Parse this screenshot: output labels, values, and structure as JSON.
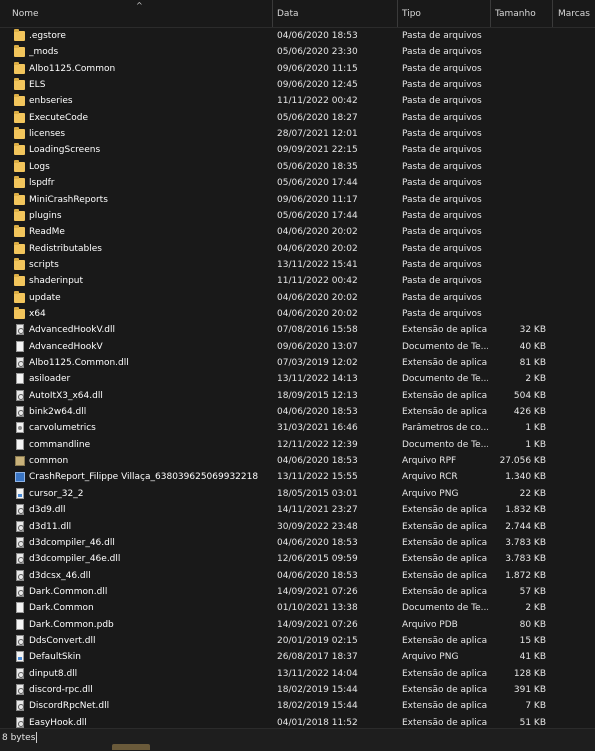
{
  "header": {
    "columns": [
      {
        "label": "Nome"
      },
      {
        "label": "Data"
      },
      {
        "label": "Tipo"
      },
      {
        "label": "Tamanho"
      },
      {
        "label": "Marcas"
      }
    ],
    "sort_indicator": "^"
  },
  "rows": [
    {
      "name": ".egstore",
      "date": "04/06/2020 18:53",
      "type": "Pasta de arquivos",
      "size": "",
      "icon": "folder-icon"
    },
    {
      "name": "_mods",
      "date": "05/06/2020 23:30",
      "type": "Pasta de arquivos",
      "size": "",
      "icon": "folder-icon"
    },
    {
      "name": "Albo1125.Common",
      "date": "09/06/2020 11:15",
      "type": "Pasta de arquivos",
      "size": "",
      "icon": "folder-icon"
    },
    {
      "name": "ELS",
      "date": "09/06/2020 12:45",
      "type": "Pasta de arquivos",
      "size": "",
      "icon": "folder-icon"
    },
    {
      "name": "enbseries",
      "date": "11/11/2022 00:42",
      "type": "Pasta de arquivos",
      "size": "",
      "icon": "folder-icon"
    },
    {
      "name": "ExecuteCode",
      "date": "05/06/2020 18:27",
      "type": "Pasta de arquivos",
      "size": "",
      "icon": "folder-icon"
    },
    {
      "name": "licenses",
      "date": "28/07/2021 12:01",
      "type": "Pasta de arquivos",
      "size": "",
      "icon": "folder-icon"
    },
    {
      "name": "LoadingScreens",
      "date": "09/09/2021 22:15",
      "type": "Pasta de arquivos",
      "size": "",
      "icon": "folder-icon"
    },
    {
      "name": "Logs",
      "date": "05/06/2020 18:35",
      "type": "Pasta de arquivos",
      "size": "",
      "icon": "folder-icon"
    },
    {
      "name": "lspdfr",
      "date": "05/06/2020 17:44",
      "type": "Pasta de arquivos",
      "size": "",
      "icon": "folder-icon"
    },
    {
      "name": "MiniCrashReports",
      "date": "09/06/2020 11:17",
      "type": "Pasta de arquivos",
      "size": "",
      "icon": "folder-icon"
    },
    {
      "name": "plugins",
      "date": "05/06/2020 17:44",
      "type": "Pasta de arquivos",
      "size": "",
      "icon": "folder-icon"
    },
    {
      "name": "ReadMe",
      "date": "04/06/2020 20:02",
      "type": "Pasta de arquivos",
      "size": "",
      "icon": "folder-icon"
    },
    {
      "name": "Redistributables",
      "date": "04/06/2020 20:02",
      "type": "Pasta de arquivos",
      "size": "",
      "icon": "folder-icon"
    },
    {
      "name": "scripts",
      "date": "13/11/2022 15:41",
      "type": "Pasta de arquivos",
      "size": "",
      "icon": "folder-icon"
    },
    {
      "name": "shaderinput",
      "date": "11/11/2022 00:42",
      "type": "Pasta de arquivos",
      "size": "",
      "icon": "folder-icon"
    },
    {
      "name": "update",
      "date": "04/06/2020 20:02",
      "type": "Pasta de arquivos",
      "size": "",
      "icon": "folder-icon"
    },
    {
      "name": "x64",
      "date": "04/06/2020 20:02",
      "type": "Pasta de arquivos",
      "size": "",
      "icon": "folder-icon"
    },
    {
      "name": "AdvancedHookV.dll",
      "date": "07/08/2016 15:58",
      "type": "Extensão de aplica...",
      "size": "32 KB",
      "icon": "dll-icon"
    },
    {
      "name": "AdvancedHookV",
      "date": "09/06/2020 13:07",
      "type": "Documento de Te...",
      "size": "40 KB",
      "icon": "file-icon"
    },
    {
      "name": "Albo1125.Common.dll",
      "date": "07/03/2019 12:02",
      "type": "Extensão de aplica...",
      "size": "81 KB",
      "icon": "dll-icon"
    },
    {
      "name": "asiloader",
      "date": "13/11/2022 14:13",
      "type": "Documento de Te...",
      "size": "2 KB",
      "icon": "file-icon"
    },
    {
      "name": "AutoItX3_x64.dll",
      "date": "18/09/2015 12:13",
      "type": "Extensão de aplica...",
      "size": "504 KB",
      "icon": "dll-icon"
    },
    {
      "name": "bink2w64.dll",
      "date": "04/06/2020 18:53",
      "type": "Extensão de aplica...",
      "size": "426 KB",
      "icon": "dll-icon"
    },
    {
      "name": "carvolumetrics",
      "date": "31/03/2021 16:46",
      "type": "Parâmetros de co...",
      "size": "1 KB",
      "icon": "config-icon"
    },
    {
      "name": "commandline",
      "date": "12/11/2022 12:39",
      "type": "Documento de Te...",
      "size": "1 KB",
      "icon": "file-icon"
    },
    {
      "name": "common",
      "date": "04/06/2020 18:53",
      "type": "Arquivo RPF",
      "size": "27.056 KB",
      "icon": "rpf-icon"
    },
    {
      "name": "CrashReport_Filippe Villaça_638039625069932218",
      "date": "13/11/2022 15:55",
      "type": "Arquivo RCR",
      "size": "1.340 KB",
      "icon": "rcr-icon"
    },
    {
      "name": "cursor_32_2",
      "date": "18/05/2015 03:01",
      "type": "Arquivo PNG",
      "size": "22 KB",
      "icon": "png-icon"
    },
    {
      "name": "d3d9.dll",
      "date": "14/11/2021 23:27",
      "type": "Extensão de aplica...",
      "size": "1.832 KB",
      "icon": "dll-icon"
    },
    {
      "name": "d3d11.dll",
      "date": "30/09/2022 23:48",
      "type": "Extensão de aplica...",
      "size": "2.744 KB",
      "icon": "dll-icon"
    },
    {
      "name": "d3dcompiler_46.dll",
      "date": "04/06/2020 18:53",
      "type": "Extensão de aplica...",
      "size": "3.783 KB",
      "icon": "dll-icon"
    },
    {
      "name": "d3dcompiler_46e.dll",
      "date": "12/06/2015 09:59",
      "type": "Extensão de aplica...",
      "size": "3.783 KB",
      "icon": "dll-icon"
    },
    {
      "name": "d3dcsx_46.dll",
      "date": "04/06/2020 18:53",
      "type": "Extensão de aplica...",
      "size": "1.872 KB",
      "icon": "dll-icon"
    },
    {
      "name": "Dark.Common.dll",
      "date": "14/09/2021 07:26",
      "type": "Extensão de aplica...",
      "size": "57 KB",
      "icon": "dll-icon"
    },
    {
      "name": "Dark.Common",
      "date": "01/10/2021 13:38",
      "type": "Documento de Te...",
      "size": "2 KB",
      "icon": "file-icon"
    },
    {
      "name": "Dark.Common.pdb",
      "date": "14/09/2021 07:26",
      "type": "Arquivo PDB",
      "size": "80 KB",
      "icon": "file-icon"
    },
    {
      "name": "DdsConvert.dll",
      "date": "20/01/2019 02:15",
      "type": "Extensão de aplica...",
      "size": "15 KB",
      "icon": "dll-icon"
    },
    {
      "name": "DefaultSkin",
      "date": "26/08/2017 18:37",
      "type": "Arquivo PNG",
      "size": "41 KB",
      "icon": "png-icon"
    },
    {
      "name": "dinput8.dll",
      "date": "13/11/2022 14:04",
      "type": "Extensão de aplica...",
      "size": "128 KB",
      "icon": "dll-icon"
    },
    {
      "name": "discord-rpc.dll",
      "date": "18/02/2019 15:44",
      "type": "Extensão de aplica...",
      "size": "391 KB",
      "icon": "dll-icon"
    },
    {
      "name": "DiscordRpcNet.dll",
      "date": "18/02/2019 15:44",
      "type": "Extensão de aplica...",
      "size": "7 KB",
      "icon": "dll-icon"
    },
    {
      "name": "EasyHook.dll",
      "date": "04/01/2018 11:52",
      "type": "Extensão de aplica...",
      "size": "51 KB",
      "icon": "dll-icon"
    }
  ],
  "status": {
    "text": "8 bytes"
  },
  "colors": {
    "background": "#191919",
    "folder": "#f2c55c",
    "text": "#ffffff"
  }
}
